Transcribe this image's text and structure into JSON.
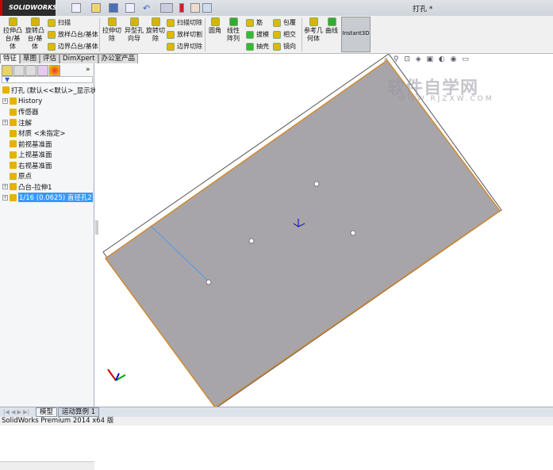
{
  "app": {
    "logo": "SOLIDWORKS",
    "window_title": "打孔 *"
  },
  "ribbon": {
    "extrude_boss": "拉伸凸台/基体",
    "revolve_boss": "旋转凸台/基体",
    "sweep": "扫描",
    "loft": "放样凸台/基体",
    "boundary": "边界凸台/基体",
    "extrude_cut": "拉伸切除",
    "hole_wizard": "异型孔向导",
    "revolve_cut": "旋转切除",
    "sweep_cut": "扫描切除",
    "loft_cut": "放样切割",
    "boundary_cut": "边界切除",
    "fillet": "圆角",
    "linear_pattern": "线性阵列",
    "rib": "筋",
    "draft": "拔模",
    "shell": "抽壳",
    "wrap": "包覆",
    "intersect": "相交",
    "mirror": "镜向",
    "ref_geometry": "参考几何体",
    "curves": "曲线",
    "instant3d": "Instant3D"
  },
  "tabs": [
    "特征",
    "草图",
    "评估",
    "DimXpert",
    "办公室产品"
  ],
  "tree": {
    "root": "打孔  (默认<<默认>_显示状态",
    "items": [
      {
        "label": "History",
        "expand": true
      },
      {
        "label": "传感器",
        "expand": false
      },
      {
        "label": "注解",
        "expand": true
      },
      {
        "label": "材质 <未指定>",
        "expand": false
      },
      {
        "label": "前视基准面",
        "expand": false
      },
      {
        "label": "上视基准面",
        "expand": false
      },
      {
        "label": "右视基准面",
        "expand": false
      },
      {
        "label": "原点",
        "expand": false
      },
      {
        "label": "凸台-拉伸1",
        "expand": true
      },
      {
        "label": "1/16 (0.0625) 直径孔2",
        "expand": true,
        "selected": true
      }
    ]
  },
  "bottom_tabs": [
    "模型",
    "运动算例 1"
  ],
  "status": "SolidWorks Premium 2014 x64 版",
  "watermark": {
    "text": "软件自学网",
    "url": "WWW.RJZXW.COM"
  },
  "colors": {
    "face": "#a8a5aa",
    "edge": "#d08a30",
    "selection": "#3399ff"
  }
}
